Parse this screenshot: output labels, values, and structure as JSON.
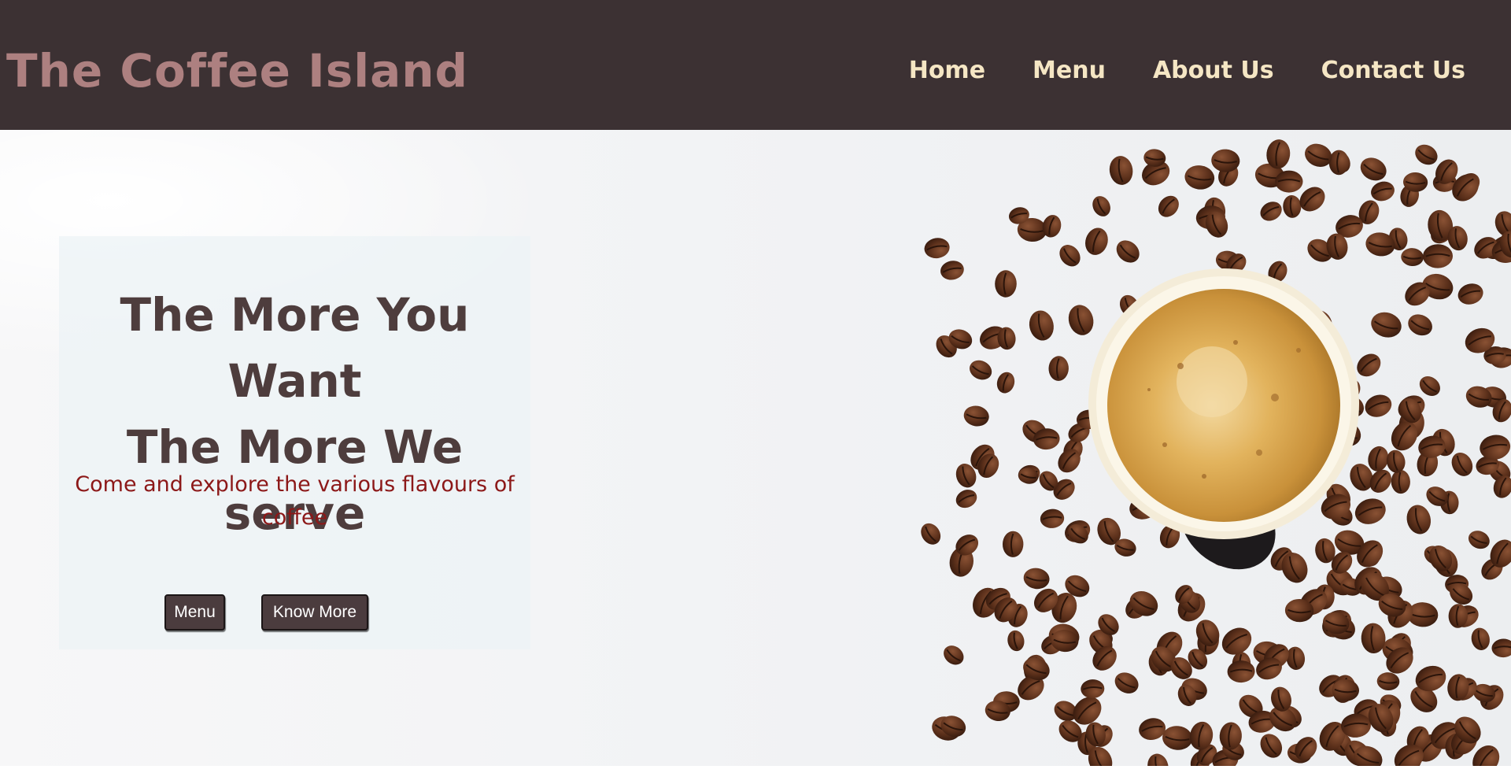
{
  "header": {
    "brand": "The Coffee Island",
    "nav": [
      "Home",
      "Menu",
      "About Us",
      "Contact Us"
    ]
  },
  "hero": {
    "headline_line1": "The More You Want",
    "headline_line2": "The More We serve",
    "tagline": "Come and explore the various flavours of coffee",
    "buttons": {
      "menu": "Menu",
      "know_more": "Know More"
    },
    "image": "coffee-cup-and-beans"
  },
  "colors": {
    "navbar_bg": "#3c3133",
    "brand": "#ad8080",
    "nav_text": "#f5e6c4",
    "headline": "#4e3d3d",
    "tagline": "#8c1818",
    "button_bg": "#4b3c3e"
  }
}
